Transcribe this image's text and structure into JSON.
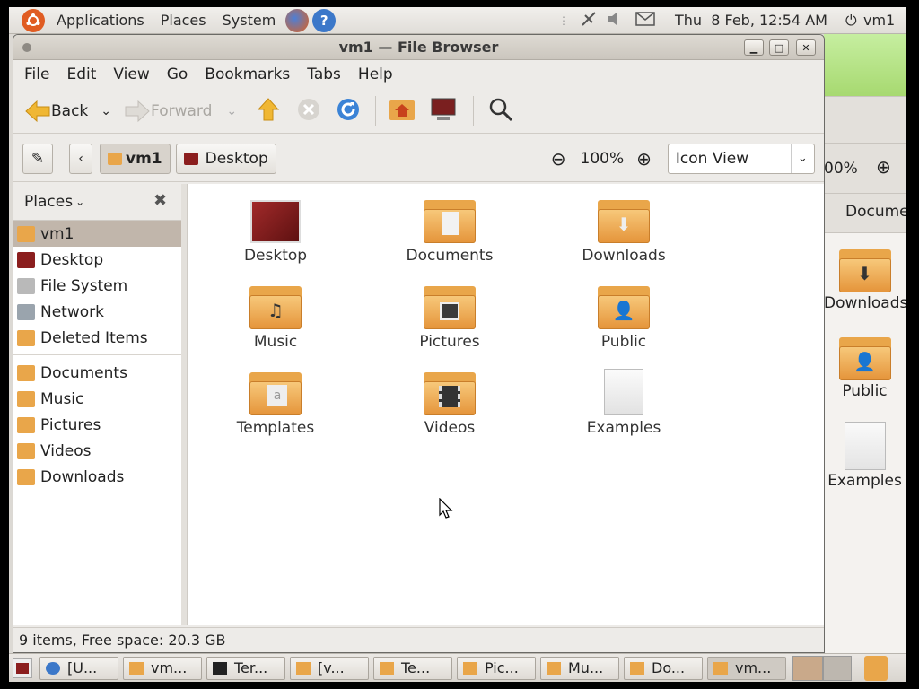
{
  "top_panel": {
    "menus": [
      "Applications",
      "Places",
      "System"
    ],
    "clock": "Thu  8 Feb, 12:54 AM",
    "user": "vm1"
  },
  "window": {
    "title": "vm1 — File Browser",
    "menu": [
      "File",
      "Edit",
      "View",
      "Go",
      "Bookmarks",
      "Tabs",
      "Help"
    ],
    "toolbar": {
      "back": "Back",
      "forward": "Forward"
    },
    "location": {
      "crumbs": [
        "vm1",
        "Desktop"
      ],
      "zoom": "100%",
      "view_mode": "Icon View"
    },
    "sidebar": {
      "header": "Places",
      "items": [
        "vm1",
        "Desktop",
        "File System",
        "Network",
        "Deleted Items",
        "Documents",
        "Music",
        "Pictures",
        "Videos",
        "Downloads"
      ]
    },
    "files": [
      "Desktop",
      "Documents",
      "Downloads",
      "Music",
      "Pictures",
      "Public",
      "Templates",
      "Videos",
      "Examples"
    ],
    "status": "9 items, Free space: 20.3 GB"
  },
  "background_window": {
    "zoom_fragment": "00%",
    "crumb_fragment": "Docume",
    "files": [
      "Downloads",
      "Public",
      "Examples"
    ]
  },
  "taskbar": [
    "[U...",
    "vm...",
    "Ter...",
    "[v...",
    "Te...",
    "Pic...",
    "Mu...",
    "Do...",
    "vm..."
  ],
  "colors": {
    "accent": "#e9a64a",
    "selection": "#c1b6ab"
  }
}
